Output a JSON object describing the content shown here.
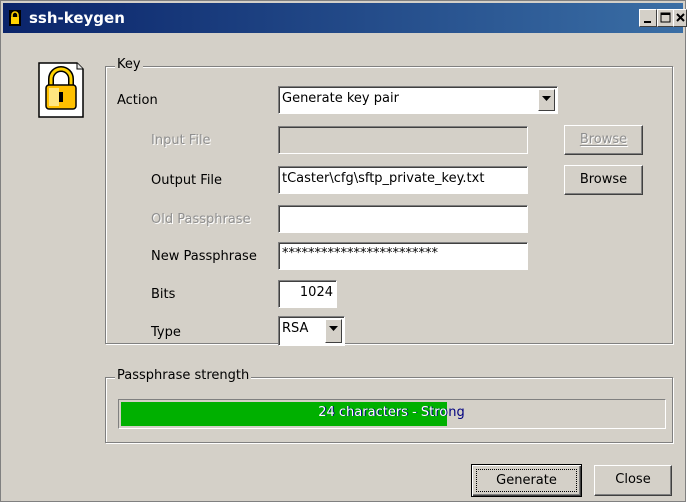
{
  "window": {
    "title": "ssh-keygen"
  },
  "icons": {
    "app": "lock-icon",
    "key": "padlock-icon",
    "minimize": "minimize-icon",
    "maximize": "maximize-icon",
    "close": "close-icon"
  },
  "key_group": {
    "legend": "Key",
    "action_label": "Action",
    "action_value": "Generate key pair",
    "input_file_label": "Input File",
    "input_file_value": "",
    "input_browse": "Browse",
    "output_file_label": "Output File",
    "output_file_value": "tCaster\\cfg\\sftp_private_key.txt",
    "output_browse": "Browse",
    "old_passphrase_label": "Old Passphrase",
    "old_passphrase_value": "",
    "new_passphrase_label": "New Passphrase",
    "new_passphrase_value": "************************",
    "bits_label": "Bits",
    "bits_value": "1024",
    "type_label": "Type",
    "type_value": "RSA"
  },
  "strength_group": {
    "legend": "Passphrase strength",
    "text": "24 characters - Strong",
    "fraction": 0.6
  },
  "buttons": {
    "generate": "Generate",
    "close": "Close"
  },
  "colors": {
    "titlebar_start": "#0a246a",
    "titlebar_end": "#3a6ea5",
    "progress_fill": "#00b000",
    "progress_text": "#000080"
  }
}
